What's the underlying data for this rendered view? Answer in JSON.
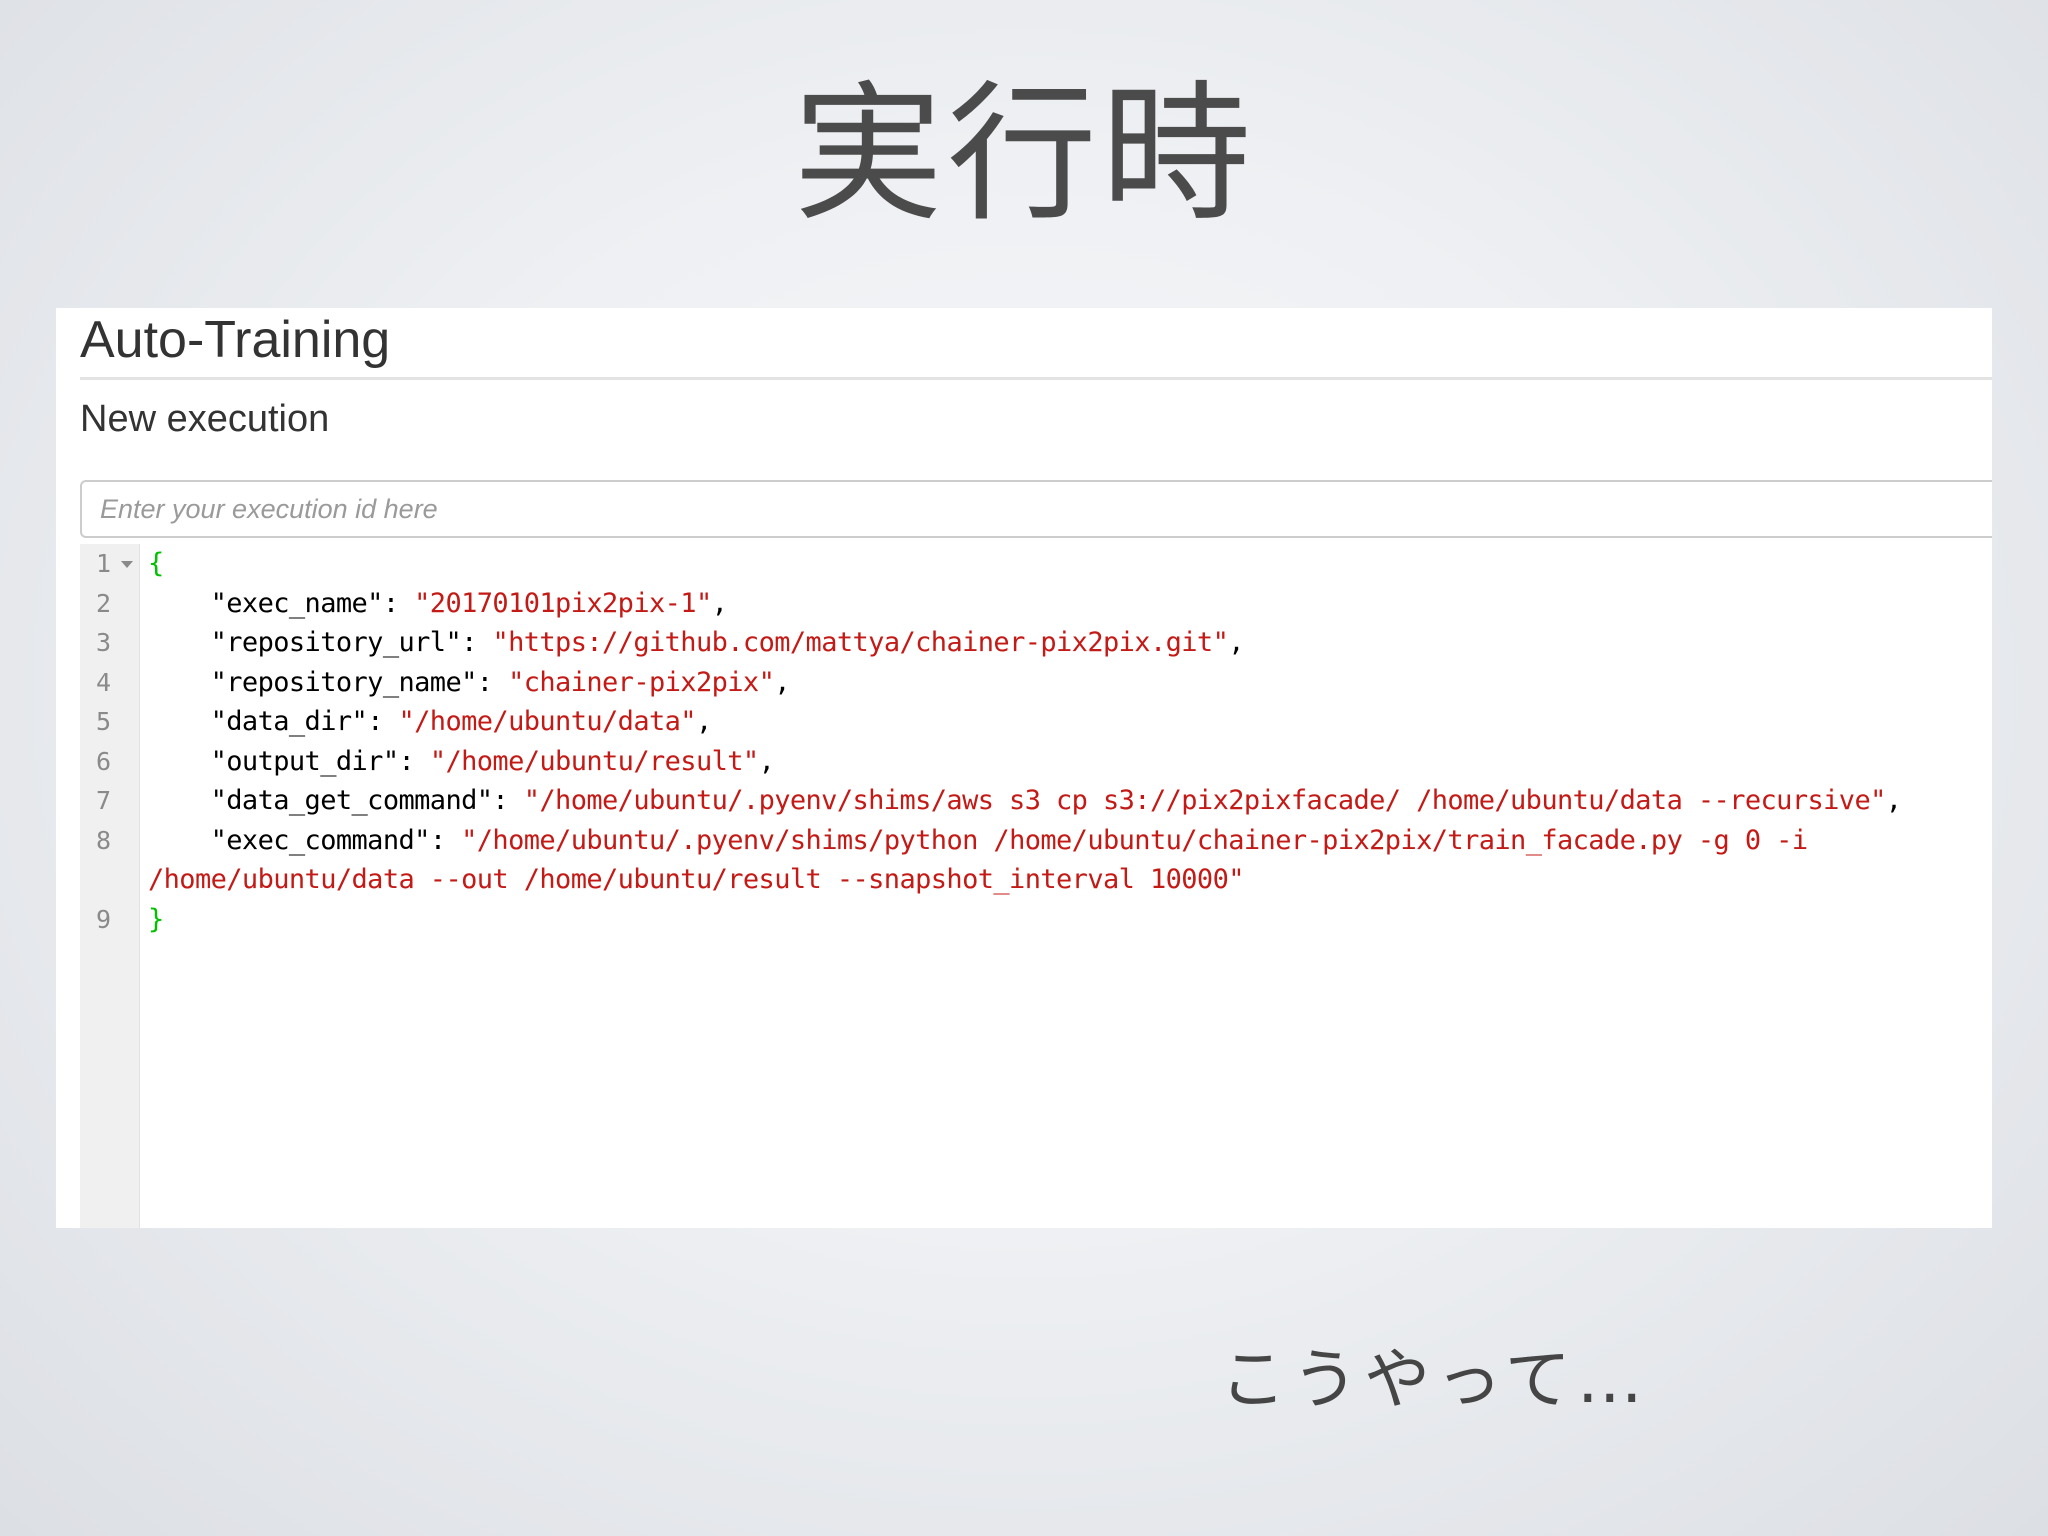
{
  "slide": {
    "title": "実行時",
    "footer": "こうやって…"
  },
  "app": {
    "title": "Auto-Training",
    "subtitle": "New execution",
    "execution_input": {
      "placeholder": "Enter your execution id here",
      "value": ""
    }
  },
  "editor": {
    "line_numbers": [
      "1",
      "2",
      "3",
      "4",
      "5",
      "6",
      "7",
      "8",
      "9"
    ],
    "fold_marker_icon": "triangle-down",
    "colors": {
      "brace": "#00c200",
      "key": "#000000",
      "string": "#c41a16",
      "gutter_bg": "#f0f0f0",
      "line_number": "#8a8a8a"
    },
    "open_brace": "{",
    "close_brace": "}",
    "entries": [
      {
        "key": "\"exec_name\"",
        "value": "\"20170101pix2pix-1\"",
        "trail": ","
      },
      {
        "key": "\"repository_url\"",
        "value": "\"https://github.com/mattya/chainer-pix2pix.git\"",
        "trail": ","
      },
      {
        "key": "\"repository_name\"",
        "value": "\"chainer-pix2pix\"",
        "trail": ","
      },
      {
        "key": "\"data_dir\"",
        "value": "\"/home/ubuntu/data\"",
        "trail": ","
      },
      {
        "key": "\"output_dir\"",
        "value": "\"/home/ubuntu/result\"",
        "trail": ","
      },
      {
        "key": "\"data_get_command\"",
        "value": "\"/home/ubuntu/.pyenv/shims/aws s3 cp s3://pix2pixfacade/ /home/ubuntu/data --recursive\"",
        "trail": ","
      },
      {
        "key": "\"exec_command\"",
        "value": "\"/home/ubuntu/.pyenv/shims/python /home/ubuntu/chainer-pix2pix/train_facade.py -g 0 -i",
        "trail": ""
      }
    ],
    "wrapped_continuation": "/home/ubuntu/data --out /home/ubuntu/result --snapshot_interval 10000\""
  }
}
